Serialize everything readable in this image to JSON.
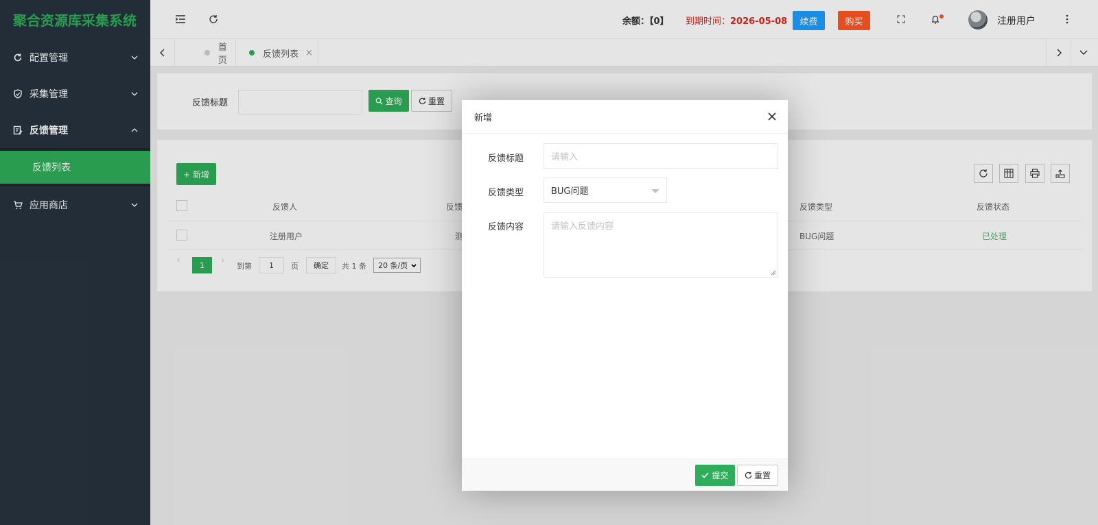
{
  "app": {
    "title": "聚合资源库采集系统"
  },
  "sidebar": {
    "items": [
      {
        "label": "配置管理",
        "icon": "refresh-icon",
        "state": "collapsed"
      },
      {
        "label": "采集管理",
        "icon": "shield-icon",
        "state": "collapsed"
      },
      {
        "label": "反馈管理",
        "icon": "edit-document-icon",
        "state": "expanded"
      },
      {
        "label": "应用商店",
        "icon": "cart-icon",
        "state": "collapsed"
      }
    ],
    "active_sub": "反馈列表"
  },
  "header": {
    "balance_label": "余额：【0】",
    "expire_label": "到期时间：",
    "expire_date": "2026-05-08",
    "renew_label": "续费",
    "buy_label": "购买",
    "username": "注册用户"
  },
  "tabs": [
    {
      "label": "首页",
      "active": false
    },
    {
      "label": "反馈列表",
      "active": true,
      "close": "×"
    }
  ],
  "search": {
    "title_label": "反馈标题",
    "query_label": "查询",
    "reset_label": "重置"
  },
  "table": {
    "add_label": "+ 新增",
    "columns": [
      "反馈人",
      "反馈",
      "反馈类型",
      "反馈状态"
    ],
    "rows": [
      {
        "user": "注册用户",
        "title": "测",
        "type": "BUG问题",
        "status": "已处理"
      }
    ]
  },
  "pager": {
    "current": "1",
    "goto_label": "到第",
    "goto_value": "1",
    "page_label": "页",
    "confirm_label": "确定",
    "total_label": "共 1 条",
    "size_label": "20 条/页"
  },
  "modal": {
    "title": "新增",
    "field_title_label": "反馈标题",
    "field_title_placeholder": "请输入",
    "field_type_label": "反馈类型",
    "field_type_value": "BUG问题",
    "field_content_label": "反馈内容",
    "field_content_placeholder": "请输入反馈内容",
    "submit_label": "提交",
    "reset_label": "重置"
  },
  "colors": {
    "brand_green": "#2eae5a",
    "sidebar_bg": "#28333e",
    "renew_blue": "#1e9fff",
    "buy_orange": "#ff5722",
    "expire_red": "#e2231a",
    "status_green": "#5fb878"
  }
}
